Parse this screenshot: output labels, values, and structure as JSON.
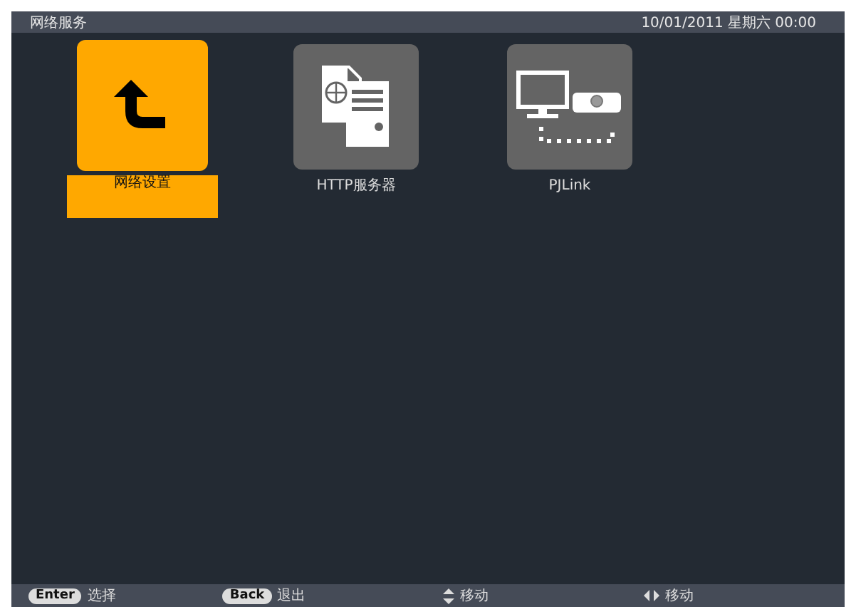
{
  "title_bar": {
    "title": "网络服务",
    "datetime": "10/01/2011 星期六 00:00"
  },
  "tiles": [
    {
      "kind": "back",
      "label": "网络设置",
      "selected": true
    },
    {
      "kind": "server",
      "label": "HTTP服务器",
      "selected": false
    },
    {
      "kind": "projector",
      "label": "PJLink",
      "selected": false
    }
  ],
  "footer": [
    {
      "kind": "key",
      "key": "Enter",
      "text": "选择"
    },
    {
      "kind": "key",
      "key": "Back",
      "text": "退出"
    },
    {
      "kind": "updown",
      "text": "移动"
    },
    {
      "kind": "leftright",
      "text": "移动"
    }
  ]
}
